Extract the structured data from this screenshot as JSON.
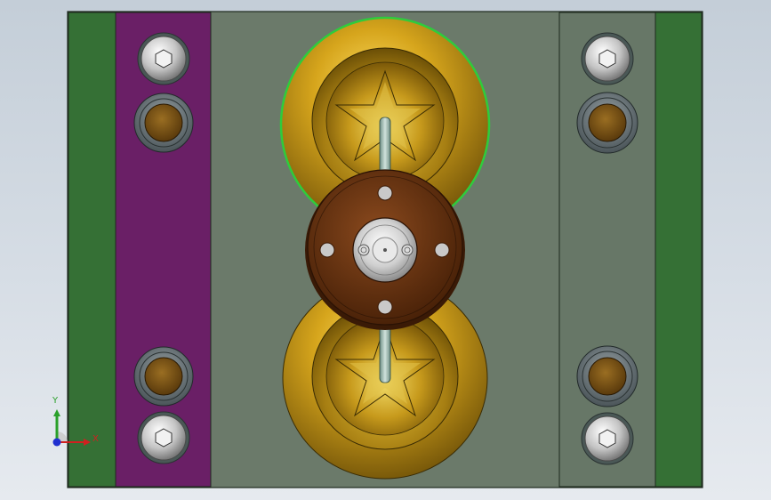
{
  "viewport": {
    "colors": {
      "background_top": "#c4ced8",
      "background_bottom": "#e6eaef",
      "outer_plate": "#6b7a6a",
      "green_rail": "#357035",
      "purple_rail": "#6a1f66",
      "gold": "#c8a018",
      "gold_dark": "#8a6c10",
      "brown_flange": "#6a3414",
      "bolt_silver": "#c8c8c8",
      "bushing_bronze": "#7a5518",
      "highlight_edge": "#2ecc3c"
    },
    "components": {
      "rails": [
        "green-rail-left",
        "purple-rail",
        "grey-rail-right",
        "green-rail-right"
      ],
      "cavities": [
        "upper-star-cavity",
        "lower-star-cavity"
      ],
      "flange": "locating-ring",
      "fasteners": [
        "hex-socket-bolt",
        "hex-socket-bolt",
        "hex-socket-bolt",
        "hex-socket-bolt"
      ],
      "bushings": [
        "guide-bushing",
        "guide-bushing",
        "guide-bushing",
        "guide-bushing"
      ]
    }
  },
  "triad": {
    "y_label": "Y",
    "x_label": "X",
    "y_color": "#2aa02a",
    "x_color": "#d02020",
    "z_color": "#2030d0"
  }
}
